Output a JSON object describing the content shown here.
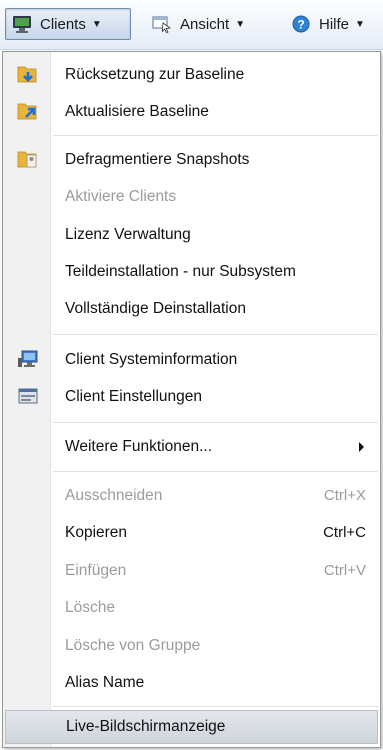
{
  "toolbar": {
    "buttons": [
      {
        "label": "Clients",
        "icon": "monitor-icon"
      },
      {
        "label": "Ansicht",
        "icon": "view-icon"
      },
      {
        "label": "Hilfe",
        "icon": "help-icon"
      }
    ]
  },
  "menu": {
    "items": [
      {
        "label": "Rücksetzung zur Baseline",
        "icon": "folder-reset-icon"
      },
      {
        "label": "Aktualisiere Baseline",
        "icon": "folder-update-icon"
      },
      {
        "label": "Defragmentiere Snapshots",
        "icon": "folder-defrag-icon"
      },
      {
        "label": "Aktiviere Clients"
      },
      {
        "label": "Lizenz Verwaltung"
      },
      {
        "label": "Teildeinstallation - nur Subsystem"
      },
      {
        "label": "Vollständige Deinstallation"
      },
      {
        "label": "Client Systeminformation",
        "icon": "computer-info-icon"
      },
      {
        "label": "Client Einstellungen",
        "icon": "settings-window-icon"
      },
      {
        "label": "Weitere Funktionen..."
      },
      {
        "label": "Ausschneiden",
        "shortcut": "Ctrl+X"
      },
      {
        "label": "Kopieren",
        "shortcut": "Ctrl+C"
      },
      {
        "label": "Einfügen",
        "shortcut": "Ctrl+V"
      },
      {
        "label": "Lösche"
      },
      {
        "label": "Lösche von Gruppe"
      },
      {
        "label": "Alias Name"
      },
      {
        "label": "Live-Bildschirmanzeige"
      }
    ]
  },
  "colors": {
    "disabled_text": "#9b9b9b",
    "highlight": "#d6dae0",
    "accent_blue": "#1f7ad6"
  }
}
